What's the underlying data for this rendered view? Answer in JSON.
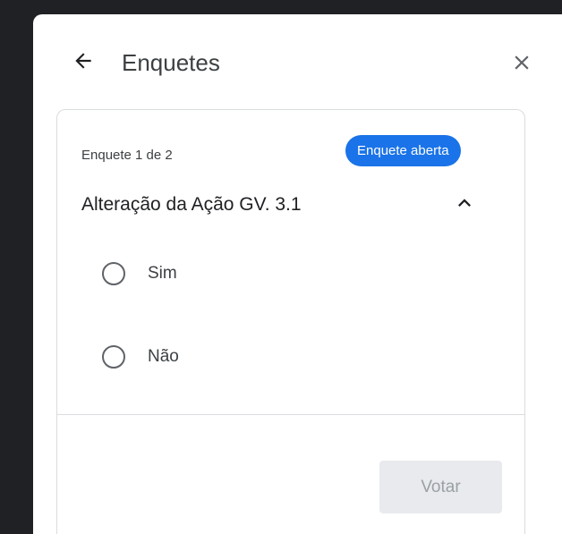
{
  "header": {
    "title": "Enquetes",
    "back_icon": "arrow-back-icon",
    "close_icon": "close-icon"
  },
  "poll": {
    "counter": "Enquete 1 de 2",
    "status": "Enquete aberta",
    "question": "Alteração da Ação GV. 3.1",
    "collapse_icon": "chevron-up-icon",
    "options": [
      {
        "label": "Sim",
        "selected": false
      },
      {
        "label": "Não",
        "selected": false
      }
    ],
    "vote_label": "Votar",
    "vote_enabled": false
  },
  "colors": {
    "accent": "#1a73e8",
    "panel_background": "#ffffff",
    "page_background": "#202124",
    "disabled_button_bg": "#e8eaed",
    "disabled_button_text": "#9aa0a6"
  }
}
